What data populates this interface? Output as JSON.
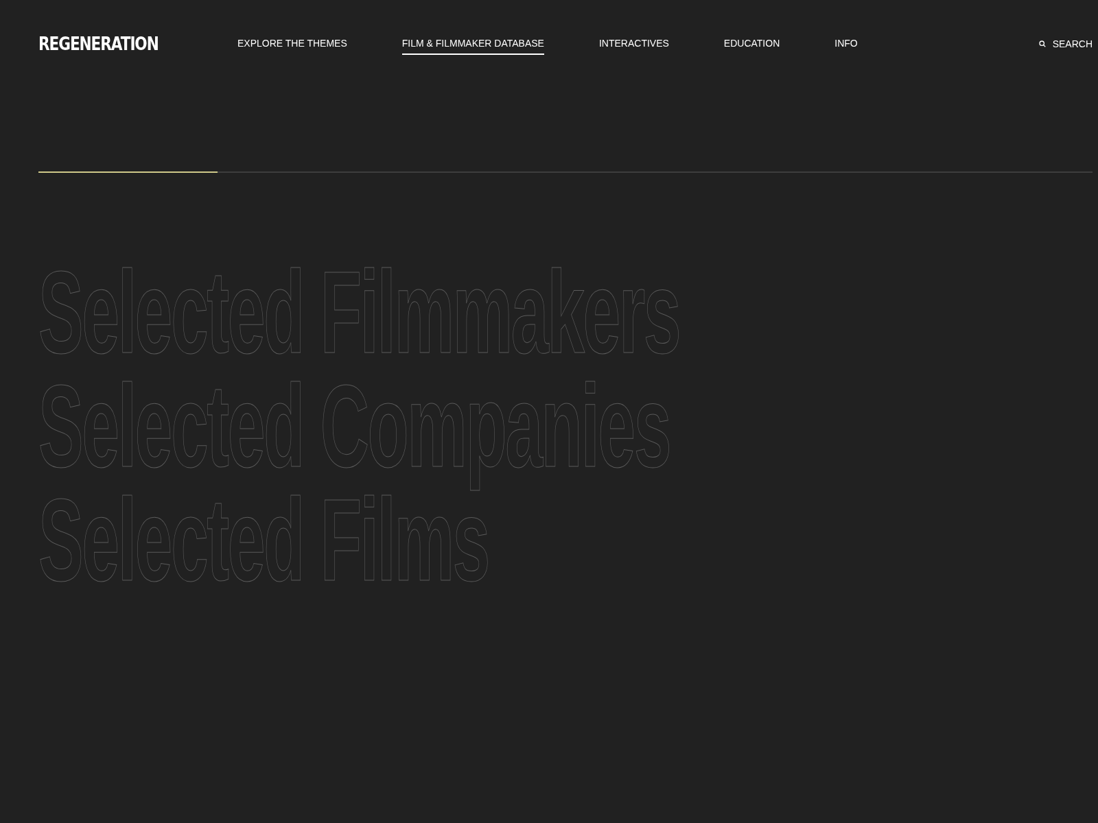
{
  "header": {
    "logo": "REGENERATION",
    "nav": [
      {
        "label": "EXPLORE THE THEMES",
        "selected": false
      },
      {
        "label": "FILM & FILMMAKER DATABASE",
        "selected": true
      },
      {
        "label": "INTERACTIVES",
        "selected": false
      },
      {
        "label": "EDUCATION",
        "selected": false
      },
      {
        "label": "INFO",
        "selected": false
      }
    ],
    "search": "SEARCH"
  },
  "progress": {
    "level": 0.17
  },
  "headings": [
    "Selected Filmmakers",
    "Selected Companies",
    "Selected Films"
  ]
}
